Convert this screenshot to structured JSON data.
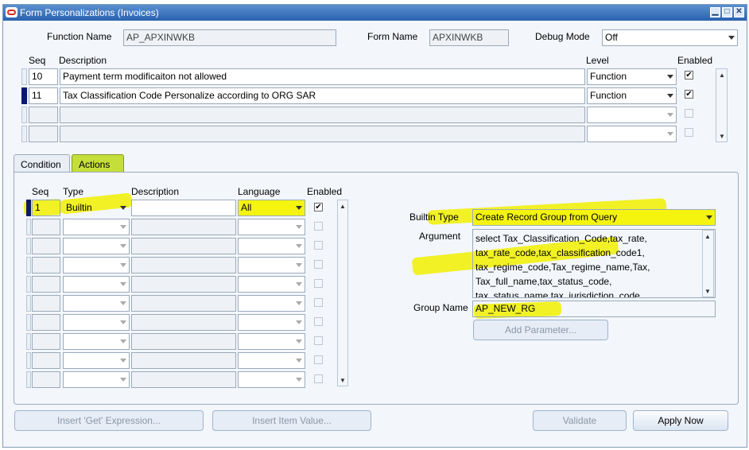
{
  "window": {
    "title": "Form Personalizations (Invoices)"
  },
  "header": {
    "function_name_label": "Function Name",
    "function_name_value": "AP_APXINWKB",
    "form_name_label": "Form Name",
    "form_name_value": "APXINWKB",
    "debug_mode_label": "Debug Mode",
    "debug_mode_value": "Off"
  },
  "rules": {
    "col_seq": "Seq",
    "col_description": "Description",
    "col_level": "Level",
    "col_enabled": "Enabled",
    "rows": [
      {
        "seq": "10",
        "description": "Payment term modificaiton not allowed",
        "level": "Function",
        "enabled": true
      },
      {
        "seq": "11",
        "description": "Tax Classification Code Personalize according to ORG SAR",
        "level": "Function",
        "enabled": true
      },
      {
        "seq": "",
        "description": "",
        "level": "",
        "enabled": false
      },
      {
        "seq": "",
        "description": "",
        "level": "",
        "enabled": false
      }
    ]
  },
  "tabs": [
    {
      "label": "Condition"
    },
    {
      "label": "Actions"
    }
  ],
  "actions": {
    "col_seq": "Seq",
    "col_type": "Type",
    "col_description": "Description",
    "col_language": "Language",
    "col_enabled": "Enabled",
    "first_row": {
      "seq": "1",
      "type": "Builtin",
      "description": "",
      "language": "All",
      "enabled": true
    }
  },
  "builtin": {
    "type_label": "Builtin Type",
    "type_value": "Create Record Group from Query",
    "argument_label": "Argument",
    "argument_lines": [
      "select Tax_Classification_Code,tax_rate,",
      "tax_rate_code,tax_classification_code1,",
      "tax_regime_code,Tax_regime_name,Tax,",
      "Tax_full_name,tax_status_code,",
      "tax_status_name,tax_jurisdiction_code"
    ],
    "group_name_label": "Group Name",
    "group_name_value": "AP_NEW_RG",
    "add_parameter": "Add Parameter..."
  },
  "footer": {
    "insert_get": "Insert 'Get' Expression...",
    "insert_item": "Insert Item Value...",
    "validate": "Validate",
    "apply_now": "Apply Now"
  },
  "colors": {
    "titlebar": "#2a62b0",
    "highlight": "#f4f40f",
    "active_tab": "#c5de3a"
  }
}
